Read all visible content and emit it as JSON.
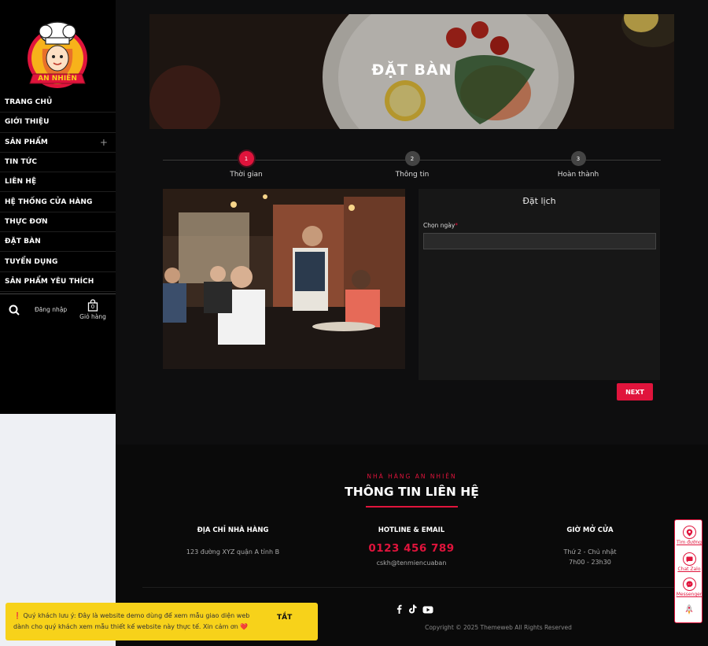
{
  "brand": {
    "logo_text": "AN NHIÊN"
  },
  "sidebar": {
    "items": [
      {
        "label": "TRANG CHỦ"
      },
      {
        "label": "GIỚI THIỆU"
      },
      {
        "label": "SẢN PHẨM",
        "expand": "+"
      },
      {
        "label": "TIN TỨC"
      },
      {
        "label": "LIÊN HỆ"
      },
      {
        "label": "HỆ THỐNG CỬA HÀNG"
      },
      {
        "label": "THỰC ĐƠN"
      },
      {
        "label": "ĐẶT BÀN"
      },
      {
        "label": "TUYỂN DỤNG"
      },
      {
        "label": "SẢN PHẨM YÊU THÍCH"
      }
    ],
    "login_label": "Đăng nhập",
    "cart_label": "Giỏ hàng",
    "cart_count": "0"
  },
  "hero": {
    "title": "ĐẶT BÀN"
  },
  "steps": [
    {
      "num": "1",
      "label": "Thời gian",
      "active": true
    },
    {
      "num": "2",
      "label": "Thông tin",
      "active": false
    },
    {
      "num": "3",
      "label": "Hoàn thành",
      "active": false
    }
  ],
  "form": {
    "title": "Đặt lịch",
    "date_label": "Chọn ngày",
    "required_mark": "*",
    "date_value": "",
    "next_label": "NEXT"
  },
  "footer": {
    "eyebrow": "NHÀ HÀNG AN NHIÊN",
    "heading": "THÔNG TIN LIÊN HỆ",
    "address": {
      "title": "ĐỊA CHỈ NHÀ HÀNG",
      "text": "123 đường XYZ quận A tỉnh B"
    },
    "contact": {
      "title": "HOTLINE & EMAIL",
      "phone": "0123 456 789",
      "email": "cskh@tenmiencuaban"
    },
    "hours": {
      "title": "GIỜ MỞ CỬA",
      "days": "Thứ 2 - Chủ nhật",
      "time": "7h00 - 23h30"
    },
    "copyright": "Copyright © 2025 Themeweb All Rights Reserved"
  },
  "notice": {
    "text": "❗ Quý khách lưu ý: Đây là website demo dùng để xem mẫu giao diện web dành cho quý khách xem mẫu thiết kế website này thực tế. Xin cảm ơn ❤️",
    "close_label": "TẮT"
  },
  "floating": {
    "directions_label": "Tìm đường",
    "zalo_label": "Chat Zalo",
    "messenger_label": "Messenger"
  },
  "colors": {
    "accent": "#e0143c",
    "notice_bg": "#f7d21a",
    "background": "#0e0e0f"
  }
}
